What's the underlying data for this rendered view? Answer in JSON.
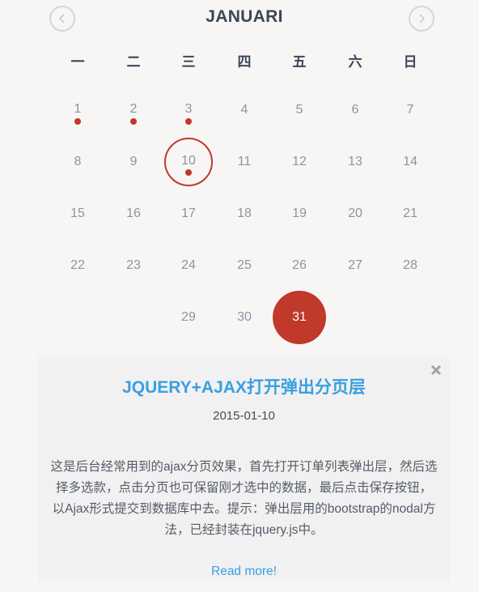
{
  "calendar": {
    "month": "JANUARI",
    "prev_icon": "chevron-left-icon",
    "next_icon": "chevron-right-icon",
    "weekdays": [
      "一",
      "二",
      "三",
      "四",
      "五",
      "六",
      "日"
    ],
    "weeks": [
      [
        {
          "d": "1",
          "event": true
        },
        {
          "d": "2",
          "event": true
        },
        {
          "d": "3",
          "event": true
        },
        {
          "d": "4"
        },
        {
          "d": "5"
        },
        {
          "d": "6"
        },
        {
          "d": "7"
        }
      ],
      [
        {
          "d": "8"
        },
        {
          "d": "9"
        },
        {
          "d": "10",
          "event": true,
          "selected": true
        },
        {
          "d": "11"
        },
        {
          "d": "12"
        },
        {
          "d": "13"
        },
        {
          "d": "14"
        }
      ],
      [
        {
          "d": "15"
        },
        {
          "d": "16"
        },
        {
          "d": "17"
        },
        {
          "d": "18"
        },
        {
          "d": "19"
        },
        {
          "d": "20"
        },
        {
          "d": "21"
        }
      ],
      [
        {
          "d": "22"
        },
        {
          "d": "23"
        },
        {
          "d": "24"
        },
        {
          "d": "25"
        },
        {
          "d": "26"
        },
        {
          "d": "27"
        },
        {
          "d": "28"
        }
      ],
      [
        null,
        null,
        {
          "d": "29"
        },
        {
          "d": "30"
        },
        {
          "d": "31",
          "today": true
        },
        null,
        null
      ]
    ],
    "accent_color": "#c0392b"
  },
  "event_card": {
    "close_icon": "close-icon",
    "title": "JQUERY+AJAX打开弹出分页层",
    "date": "2015-01-10",
    "body": "这是后台经常用到的ajax分页效果，首先打开订单列表弹出层，然后选择多选款，点击分页也可保留刚才选中的数据，最后点击保存按钮，以Ajax形式提交到数据库中去。提示：弹出层用的bootstrap的nodal方法，已经封装在jquery.js中。",
    "read_more": "Read more!",
    "link_color": "#3a9fe0"
  }
}
